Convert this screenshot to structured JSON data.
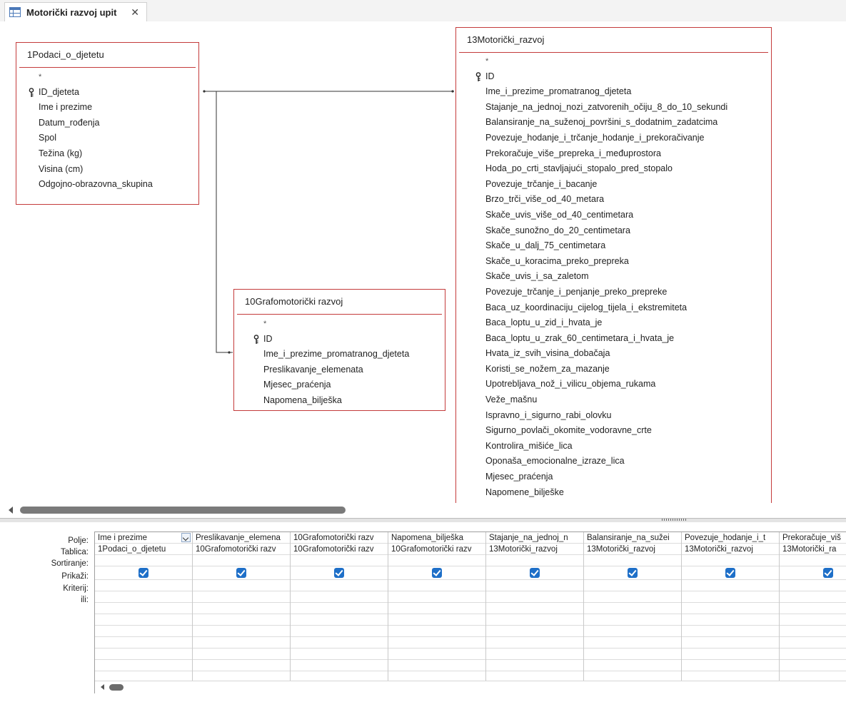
{
  "tab": {
    "title": "Motorički razvoj upit",
    "close": "✕"
  },
  "tables": {
    "podaci": {
      "title": "1Podaci_o_djetetu",
      "fields": [
        "*",
        "ID_djeteta",
        "Ime i prezime",
        "Datum_rođenja",
        "Spol",
        "Težina (kg)",
        "Visina (cm)",
        "Odgojno-obrazovna_skupina"
      ]
    },
    "grafo": {
      "title": "10Grafomotorički razvoj",
      "fields": [
        "*",
        "ID",
        "Ime_i_prezime_promatranog_djeteta",
        "Preslikavanje_elemenata",
        "Mjesec_praćenja",
        "Napomena_bilješka"
      ]
    },
    "motoricki": {
      "title": "13Motorički_razvoj",
      "fields": [
        "*",
        "ID",
        "Ime_i_prezime_promatranog_djeteta",
        "Stajanje_na_jednoj_nozi_zatvorenih_očiju_8_do_10_sekundi",
        "Balansiranje_na_suženoj_površini_s_dodatnim_zadatcima",
        "Povezuje_hodanje_i_trčanje_hodanje_i_prekoračivanje",
        "Prekoračuje_više_prepreka_i_međuprostora",
        "Hoda_po_crti_stavljajući_stopalo_pred_stopalo",
        "Povezuje_trčanje_i_bacanje",
        "Brzo_trči_više_od_40_metara",
        "Skače_uvis_više_od_40_centimetara",
        "Skače_sunožno_do_20_centimetara",
        "Skače_u_dalj_75_centimetara",
        "Skače_u_koracima_preko_prepreka",
        "Skače_uvis_i_sa_zaletom",
        "Povezuje_trčanje_i_penjanje_preko_prepreke",
        "Baca_uz_koordinaciju_cijelog_tijela_i_ekstremiteta",
        "Baca_loptu_u_zid_i_hvata_je",
        "Baca_loptu_u_zrak_60_centimetara_i_hvata_je",
        "Hvata_iz_svih_visina_dobačaja",
        "Koristi_se_nožem_za_mazanje",
        "Upotrebljava_nož_i_vilicu_objema_rukama",
        "Veže_mašnu",
        "Ispravno_i_sigurno_rabi_olovku",
        "Sigurno_povlači_okomite_vodoravne_crte",
        "Kontrolira_mišiće_lica",
        "Oponaša_emocionalne_izraze_lica",
        "Mjesec_praćenja",
        "Napomene_bilješke"
      ]
    }
  },
  "qbe": {
    "row_labels": {
      "polje": "Polje:",
      "tablica": "Tablica:",
      "sortiranje": "Sortiranje:",
      "prikazi": "Prikaži:",
      "kriterij": "Kriterij:",
      "ili": "ili:"
    },
    "columns": [
      {
        "field": "Ime i prezime",
        "table": "1Podaci_o_djetetu",
        "show": true
      },
      {
        "field": "Preslikavanje_elemena",
        "table": "10Grafomotorički razv",
        "show": true
      },
      {
        "field": "10Grafomotorički razv",
        "table": "10Grafomotorički razv",
        "show": true
      },
      {
        "field": "Napomena_bilješka",
        "table": "10Grafomotorički razv",
        "show": true
      },
      {
        "field": "Stajanje_na_jednoj_n",
        "table": "13Motorički_razvoj",
        "show": true
      },
      {
        "field": "Balansiranje_na_sužei",
        "table": "13Motorički_razvoj",
        "show": true
      },
      {
        "field": "Povezuje_hodanje_i_t",
        "table": "13Motorički_razvoj",
        "show": true
      },
      {
        "field": "Prekoračuje_viš",
        "table": "13Motorički_ra",
        "show": true
      }
    ]
  }
}
